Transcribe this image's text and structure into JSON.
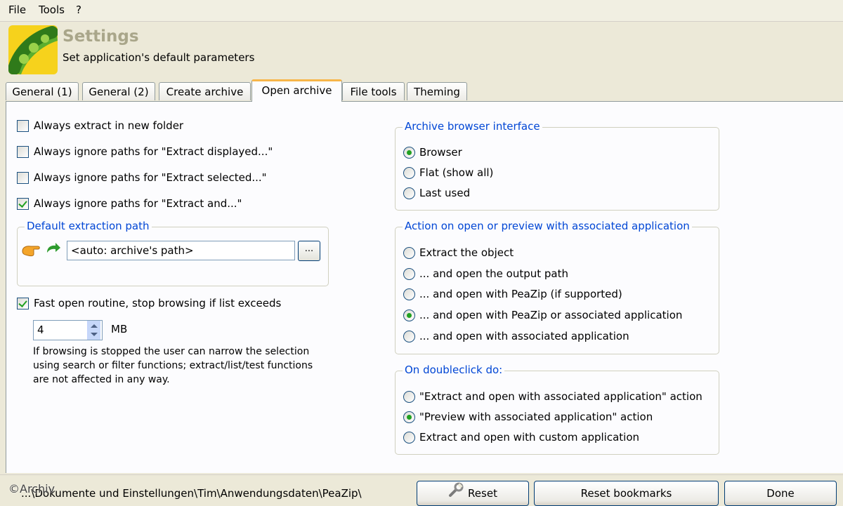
{
  "menu": {
    "file": "File",
    "tools": "Tools",
    "help": "?"
  },
  "header": {
    "title": "Settings",
    "subtitle": "Set application's default parameters"
  },
  "tabs": [
    {
      "label": "General (1)"
    },
    {
      "label": "General (2)"
    },
    {
      "label": "Create archive"
    },
    {
      "label": "Open archive"
    },
    {
      "label": "File tools"
    },
    {
      "label": "Theming"
    }
  ],
  "left": {
    "checkboxes": [
      {
        "label": "Always extract in new folder",
        "checked": false
      },
      {
        "label": "Always ignore paths for \"Extract displayed...\"",
        "checked": false
      },
      {
        "label": "Always ignore paths for \"Extract selected...\"",
        "checked": false
      },
      {
        "label": "Always ignore paths for \"Extract and...\"",
        "checked": true
      }
    ],
    "extraction_group_title": "Default extraction path",
    "extraction_path_value": "<auto: archive's path>",
    "browse_button": "...",
    "fast_open_label": "Fast open routine, stop browsing if list exceeds",
    "fast_open_checked": true,
    "size_value": "4",
    "size_unit": "MB",
    "note_lines": [
      "If browsing is stopped the user can narrow the selection",
      "using search or filter functions; extract/list/test functions",
      "are not affected in any way."
    ]
  },
  "right": {
    "browser_group": {
      "title": "Archive browser interface",
      "options": [
        {
          "label": "Browser",
          "checked": true
        },
        {
          "label": "Flat (show all)",
          "checked": false
        },
        {
          "label": "Last used",
          "checked": false
        }
      ]
    },
    "action_group": {
      "title": "Action on open or preview with associated application",
      "options": [
        {
          "label": "Extract the object",
          "checked": false
        },
        {
          "label": "... and open the output path",
          "checked": false
        },
        {
          "label": "... and open with PeaZip (if supported)",
          "checked": false
        },
        {
          "label": "... and open with PeaZip or associated application",
          "checked": true
        },
        {
          "label": "... and open with associated application",
          "checked": false
        }
      ]
    },
    "doubleclick_group": {
      "title": "On doubleclick do:",
      "options": [
        {
          "label": "\"Extract and open with associated application\" action",
          "checked": false
        },
        {
          "label": "\"Preview with associated application\" action",
          "checked": true
        },
        {
          "label": "Extract and open with custom application",
          "checked": false
        }
      ]
    }
  },
  "footer": {
    "path": "...\\Dokumente und Einstellungen\\Tim\\Anwendungsdaten\\PeaZip\\",
    "reset": "Reset",
    "reset_bookmarks": "Reset bookmarks",
    "done": "Done",
    "watermark": "©Archiv"
  }
}
